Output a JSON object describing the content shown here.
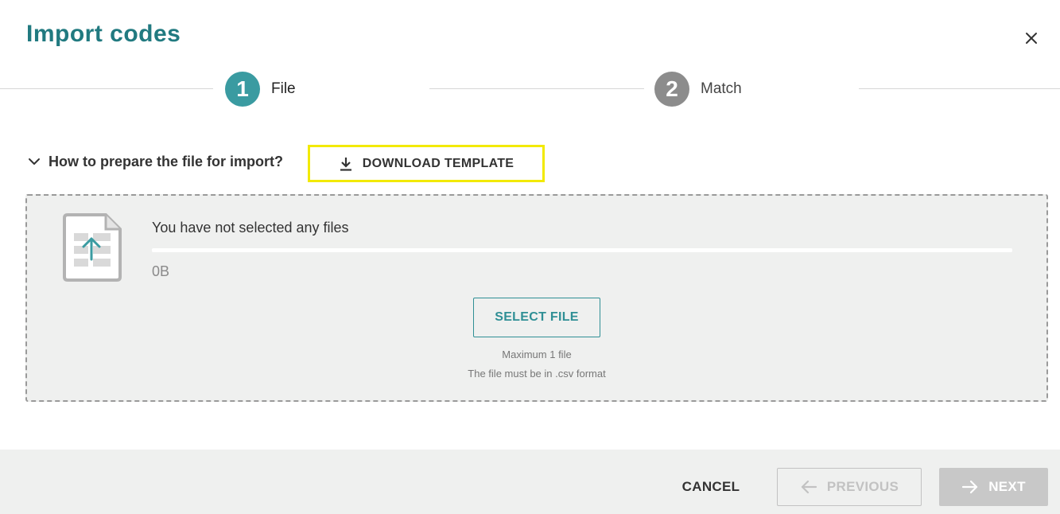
{
  "dialog": {
    "title": "Import codes",
    "close_icon": "close-icon"
  },
  "stepper": {
    "steps": [
      {
        "number": "1",
        "label": "File",
        "state": "active",
        "color": "#3a9ba1"
      },
      {
        "number": "2",
        "label": "Match",
        "state": "inactive",
        "color": "#8c8c8c"
      }
    ]
  },
  "help": {
    "toggle_label": "How to prepare the file for import?",
    "toggle_icon": "chevron-down-icon"
  },
  "download": {
    "label": "DOWNLOAD TEMPLATE",
    "icon": "download-icon",
    "highlight_color": "#f2ea00"
  },
  "dropzone": {
    "file_icon": "file-upload-icon",
    "status_text": "You have not selected any files",
    "size_text": "0B",
    "select_button_label": "SELECT FILE",
    "hint_max": "Maximum 1 file",
    "hint_format": "The file must be in .csv format"
  },
  "footer": {
    "cancel_label": "CANCEL",
    "previous_label": "PREVIOUS",
    "previous_icon": "arrow-left-icon",
    "next_label": "NEXT",
    "next_icon": "arrow-right-icon"
  },
  "colors": {
    "accent": "#217a80",
    "teal": "#2f8f95",
    "panel_bg": "#eff0ef",
    "disabled": "#c2c2c2"
  }
}
